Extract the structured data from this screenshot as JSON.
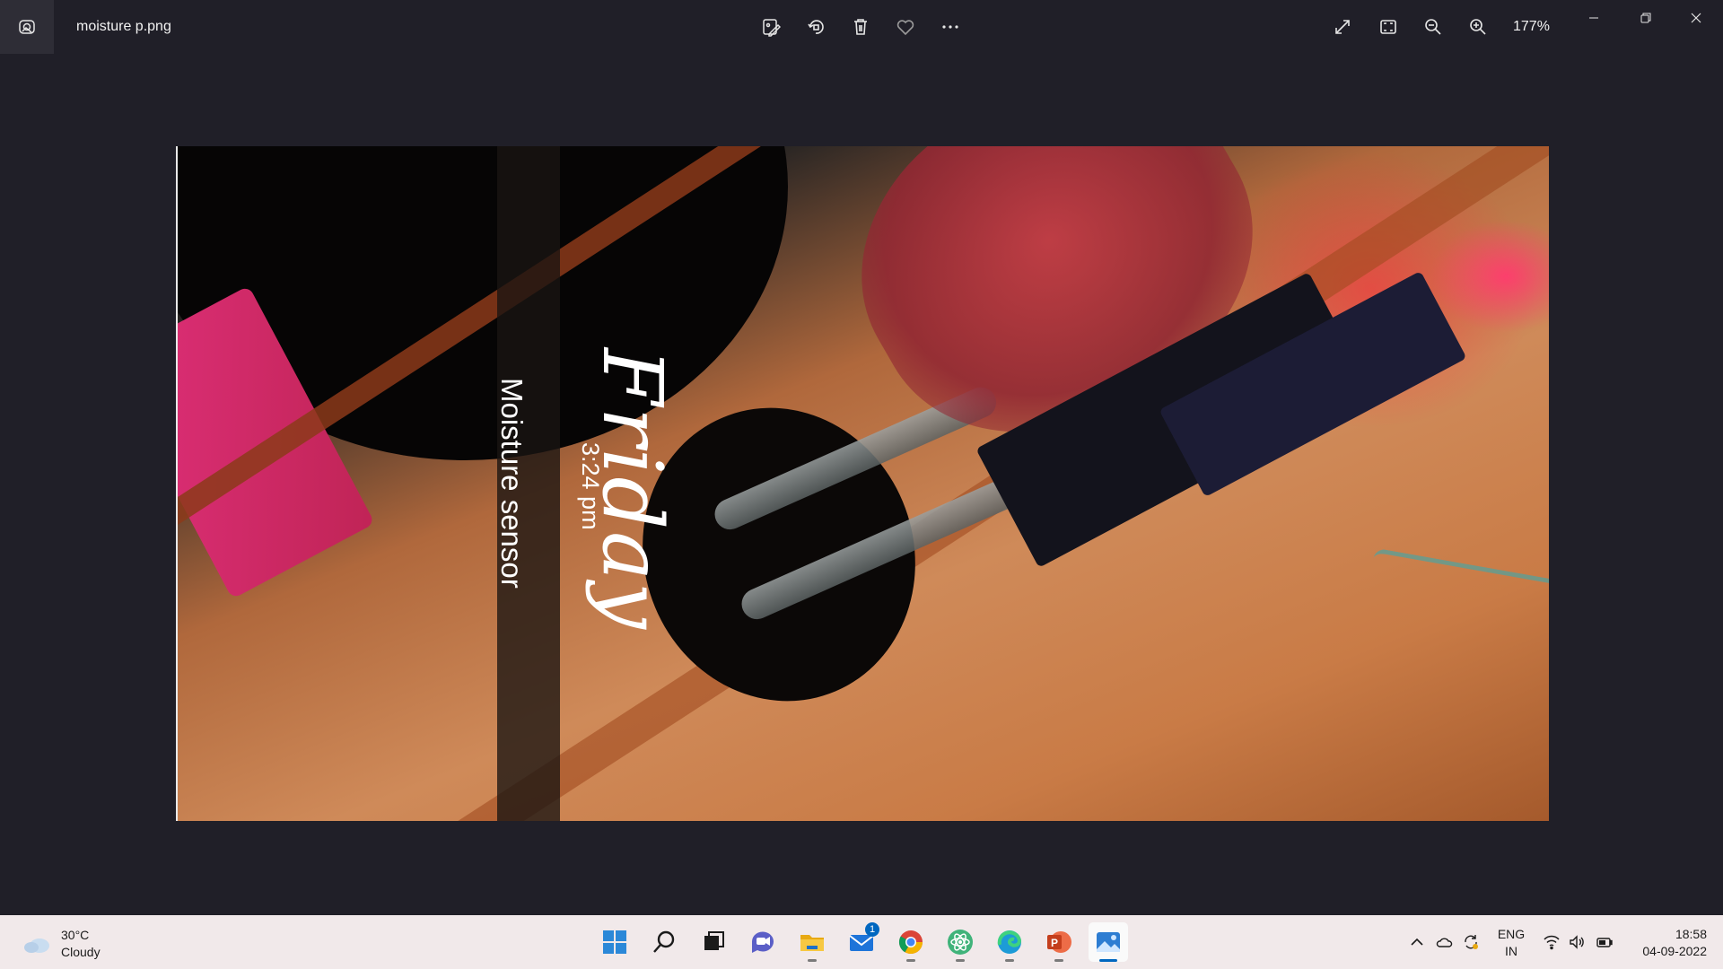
{
  "window": {
    "file_name": "moisture p.png",
    "zoom_level": "177%",
    "toolbar": {
      "edit_icon": "edit-image-icon",
      "rotate_icon": "rotate-icon",
      "delete_icon": "trash-icon",
      "favorite_icon": "heart-icon",
      "more_icon": "more-icon"
    },
    "controls": [
      "fullscreen-icon",
      "fit-to-window-icon",
      "zoom-out-icon",
      "zoom-in-icon"
    ]
  },
  "photo": {
    "caption": "Moisture sensor",
    "day": "Friday",
    "time": "3:24 pm"
  },
  "taskbar": {
    "weather": {
      "temp": "30°C",
      "condition": "Cloudy"
    },
    "apps": [
      "start",
      "search",
      "task-view",
      "teams-chat",
      "file-explorer",
      "mail",
      "chrome",
      "atom",
      "edge",
      "powerpoint",
      "photos"
    ],
    "mail_badge": "1",
    "lang_line1": "ENG",
    "lang_line2": "IN",
    "time": "18:58",
    "date": "04-09-2022"
  },
  "colors": {
    "window_bg": "#201f28",
    "taskbar_bg": "#f1e9ea",
    "accent": "#0067c0"
  }
}
